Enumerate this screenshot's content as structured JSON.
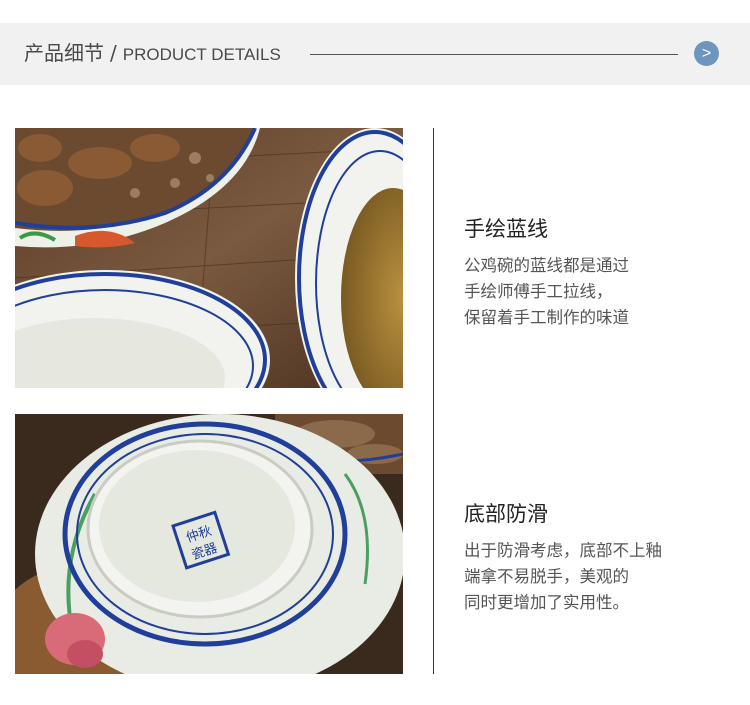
{
  "header": {
    "title_cn": "产品细节",
    "separator": "/",
    "title_en": "PRODUCT DETAILS",
    "arrow_glyph": ">"
  },
  "photos": {
    "top_alt": "bowls with food",
    "bottom_alt": "bowl bottom",
    "seal_text": "仲秋 瓷器"
  },
  "features": [
    {
      "title": "手绘蓝线",
      "lines": [
        "公鸡碗的蓝线都是通过",
        "手绘师傅手工拉线，",
        "保留着手工制作的味道"
      ]
    },
    {
      "title": "底部防滑",
      "lines": [
        "出于防滑考虑，底部不上釉",
        "端拿不易脱手，美观的",
        "同时更增加了实用性。"
      ]
    }
  ],
  "colors": {
    "header_bg": "#f1f1f1",
    "accent_arrow": "#6d95bd",
    "porcelain_blue": "#1f3f9a",
    "wood": "#6b4a32"
  }
}
